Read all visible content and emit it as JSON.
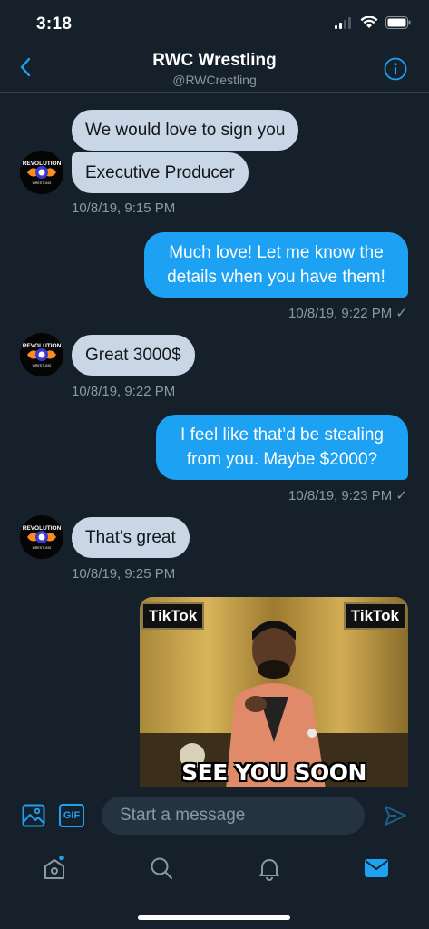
{
  "status": {
    "time": "3:18"
  },
  "header": {
    "title": "RWC Wrestling",
    "handle": "@RWCrestling"
  },
  "messages": [
    {
      "type": "in",
      "text": "We would love to sign you"
    },
    {
      "type": "in",
      "text": "Executive Producer"
    },
    {
      "type": "meta_in",
      "text": "10/8/19, 9:15 PM"
    },
    {
      "type": "out",
      "line1": "Much love! Let me know the",
      "line2": "details when you have them!"
    },
    {
      "type": "meta_out",
      "text": "10/8/19, 9:22 PM ✓"
    },
    {
      "type": "in",
      "text": "Great 3000$"
    },
    {
      "type": "meta_in",
      "text": "10/8/19, 9:22 PM"
    },
    {
      "type": "out",
      "line1": "I feel like that’d be stealing",
      "line2": "from you. Maybe $2000?"
    },
    {
      "type": "meta_out",
      "text": "10/8/19, 9:23 PM ✓"
    },
    {
      "type": "in",
      "text": "That's great"
    },
    {
      "type": "meta_in",
      "text": "10/8/19, 9:25 PM"
    }
  ],
  "avatar": {
    "label_top": "REVOLUTION",
    "label_bottom": "WRESTLING"
  },
  "gif": {
    "caption": "SEE YOU SOON",
    "sign_left": "TikTok",
    "sign_right": "TikTok"
  },
  "composer": {
    "placeholder": "Start a message",
    "gif_label": "GIF"
  },
  "colors": {
    "background": "#15202b",
    "accent": "#1da1f2",
    "incoming_bubble": "#c8d6e5",
    "muted": "#8899a6"
  },
  "icons": [
    "back-icon",
    "info-icon",
    "image-icon",
    "gif-icon",
    "send-icon",
    "home-icon",
    "search-icon",
    "notifications-icon",
    "messages-icon"
  ]
}
